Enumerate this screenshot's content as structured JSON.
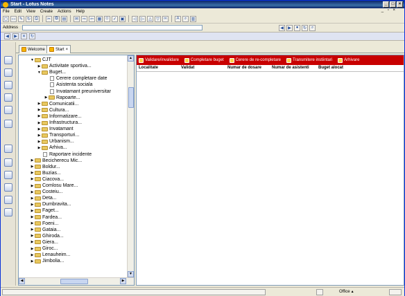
{
  "window": {
    "title": "Start - Lotus Notes"
  },
  "menu": [
    "File",
    "Edit",
    "View",
    "Create",
    "Actions",
    "Help"
  ],
  "address": {
    "label": "Address",
    "value": ""
  },
  "tabs": [
    {
      "label": "Welcome"
    },
    {
      "label": "Start"
    }
  ],
  "tree": [
    {
      "label": "CJT",
      "level": 0,
      "type": "folder",
      "twisty": "open"
    },
    {
      "label": "Activitate sportiva...",
      "level": 1,
      "type": "folder",
      "twisty": "closed"
    },
    {
      "label": "Buget...",
      "level": 1,
      "type": "folder",
      "twisty": "open"
    },
    {
      "label": "Cerere completare date",
      "level": 2,
      "type": "doc",
      "twisty": ""
    },
    {
      "label": "Asistenta sociala",
      "level": 2,
      "type": "doc",
      "twisty": ""
    },
    {
      "label": "Invatamant preuniversitar",
      "level": 2,
      "type": "doc",
      "twisty": ""
    },
    {
      "label": "Rapoarte...",
      "level": 2,
      "type": "folder",
      "twisty": "closed"
    },
    {
      "label": "Comunicatii...",
      "level": 1,
      "type": "folder",
      "twisty": "closed"
    },
    {
      "label": "Cultura...",
      "level": 1,
      "type": "folder",
      "twisty": "closed"
    },
    {
      "label": "Informatizare...",
      "level": 1,
      "type": "folder",
      "twisty": "closed"
    },
    {
      "label": "Infrastructura...",
      "level": 1,
      "type": "folder",
      "twisty": "closed"
    },
    {
      "label": "Invatamant",
      "level": 1,
      "type": "folder",
      "twisty": "closed"
    },
    {
      "label": "Transporturi...",
      "level": 1,
      "type": "folder",
      "twisty": "closed"
    },
    {
      "label": "Urbanism...",
      "level": 1,
      "type": "folder",
      "twisty": "closed"
    },
    {
      "label": "Arhiva...",
      "level": 1,
      "type": "folder",
      "twisty": "closed"
    },
    {
      "label": "Raportare incidente",
      "level": 1,
      "type": "doc",
      "twisty": ""
    },
    {
      "label": "Becicherecu Mic...",
      "level": 0,
      "type": "folder",
      "twisty": "closed"
    },
    {
      "label": "Boldur...",
      "level": 0,
      "type": "folder",
      "twisty": "closed"
    },
    {
      "label": "Buzias...",
      "level": 0,
      "type": "folder",
      "twisty": "closed"
    },
    {
      "label": "Ciacova...",
      "level": 0,
      "type": "folder",
      "twisty": "closed"
    },
    {
      "label": "Comlosu Mare...",
      "level": 0,
      "type": "folder",
      "twisty": "closed"
    },
    {
      "label": "Costeiu...",
      "level": 0,
      "type": "folder",
      "twisty": "closed"
    },
    {
      "label": "Deta...",
      "level": 0,
      "type": "folder",
      "twisty": "closed"
    },
    {
      "label": "Dumbravita...",
      "level": 0,
      "type": "folder",
      "twisty": "closed"
    },
    {
      "label": "Faget...",
      "level": 0,
      "type": "folder",
      "twisty": "closed"
    },
    {
      "label": "Fardea...",
      "level": 0,
      "type": "folder",
      "twisty": "closed"
    },
    {
      "label": "Foeni...",
      "level": 0,
      "type": "folder",
      "twisty": "closed"
    },
    {
      "label": "Gataia...",
      "level": 0,
      "type": "folder",
      "twisty": "closed"
    },
    {
      "label": "Ghiroda...",
      "level": 0,
      "type": "folder",
      "twisty": "closed"
    },
    {
      "label": "Giera...",
      "level": 0,
      "type": "folder",
      "twisty": "closed"
    },
    {
      "label": "Giroc...",
      "level": 0,
      "type": "folder",
      "twisty": "closed"
    },
    {
      "label": "Lenauheim...",
      "level": 0,
      "type": "folder",
      "twisty": "closed"
    },
    {
      "label": "Jimbolia...",
      "level": 0,
      "type": "folder",
      "twisty": "closed"
    }
  ],
  "actions": [
    {
      "label": "Validare/invalidare"
    },
    {
      "label": "Completare buget"
    },
    {
      "label": "Cerere de re-completare"
    },
    {
      "label": "Transmitere instiintari"
    },
    {
      "label": "Arhivare"
    }
  ],
  "columns": [
    {
      "label": "Localitate"
    },
    {
      "label": "Validat"
    },
    {
      "label": "Numar de dosare"
    },
    {
      "label": "Numar de asistenti"
    },
    {
      "label": "Buget alocat"
    }
  ],
  "status": {
    "location": "Office"
  },
  "colors": {
    "action_bar": "#c80000",
    "title_bar": "#0a246a"
  }
}
